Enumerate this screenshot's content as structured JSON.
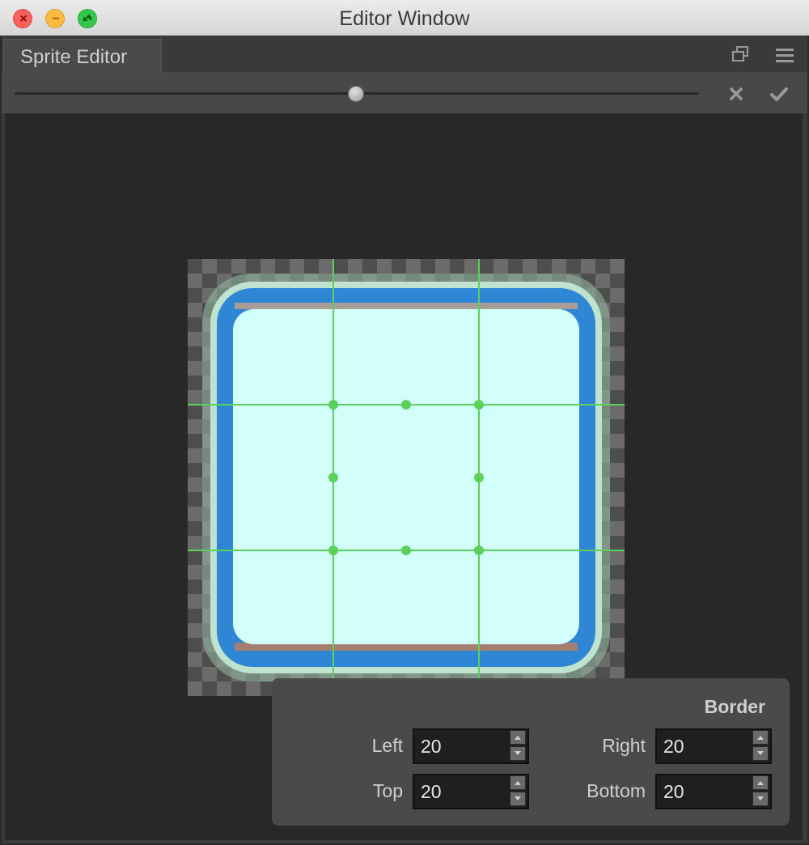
{
  "window": {
    "title": "Editor Window",
    "controls": [
      "close",
      "minimize",
      "zoom"
    ]
  },
  "tab": {
    "label": "Sprite Editor",
    "icons": [
      "restore-window-icon",
      "hamburger-menu-icon"
    ]
  },
  "toolbar": {
    "zoom_slider_fraction": 0.5,
    "cancel_icon": "cross-icon",
    "confirm_icon": "checkmark-icon"
  },
  "sprite": {
    "guide_color": "#5bd05b",
    "border_color": "#2e86d4",
    "fill_color": "#d3fffa"
  },
  "border_panel": {
    "title": "Border",
    "fields": {
      "left": {
        "label": "Left",
        "value": "20"
      },
      "right": {
        "label": "Right",
        "value": "20"
      },
      "top": {
        "label": "Top",
        "value": "20"
      },
      "bottom": {
        "label": "Bottom",
        "value": "20"
      }
    }
  }
}
